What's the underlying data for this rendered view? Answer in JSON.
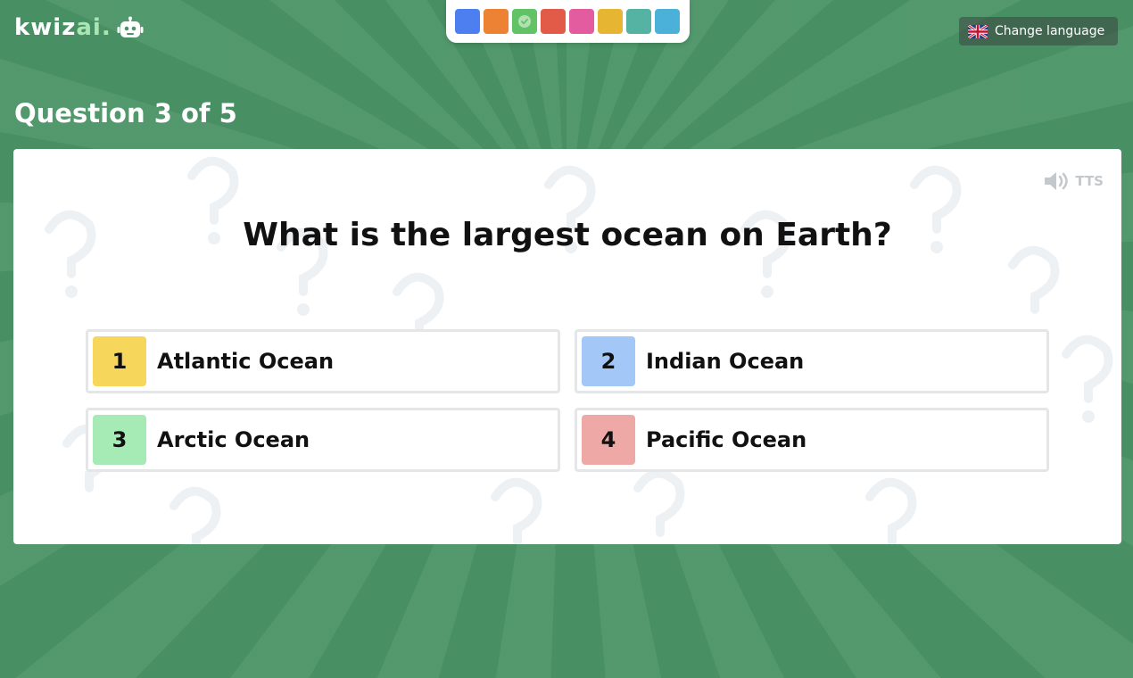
{
  "header": {
    "logo_prefix": "kwiz",
    "logo_accent": "ai.",
    "logo_icon": "robot-icon",
    "language_button_label": "Change language",
    "language_flag_icon": "uk-flag-icon"
  },
  "theme_swatches": [
    {
      "color": "#4e7ff0",
      "selected": false
    },
    {
      "color": "#ee8234",
      "selected": false
    },
    {
      "color": "#62c266",
      "selected": true
    },
    {
      "color": "#e25a48",
      "selected": false
    },
    {
      "color": "#e25c9f",
      "selected": false
    },
    {
      "color": "#e6b531",
      "selected": false
    },
    {
      "color": "#54b3a2",
      "selected": false
    },
    {
      "color": "#4bb1d8",
      "selected": false
    }
  ],
  "quiz": {
    "counter": "Question 3 of 5",
    "tts_label": "TTS",
    "tts_icon": "speaker-icon",
    "question": "What is the largest ocean on Earth?",
    "answers": [
      {
        "number": "1",
        "label": "Atlantic Ocean",
        "color": "#f7d65c"
      },
      {
        "number": "2",
        "label": "Indian Ocean",
        "color": "#a3c7f7"
      },
      {
        "number": "3",
        "label": "Arctic Ocean",
        "color": "#a6ebb5"
      },
      {
        "number": "4",
        "label": "Pacific Ocean",
        "color": "#eea9a7"
      }
    ]
  },
  "colors": {
    "background": "#4a9466",
    "accent": "#a8e6b4"
  }
}
